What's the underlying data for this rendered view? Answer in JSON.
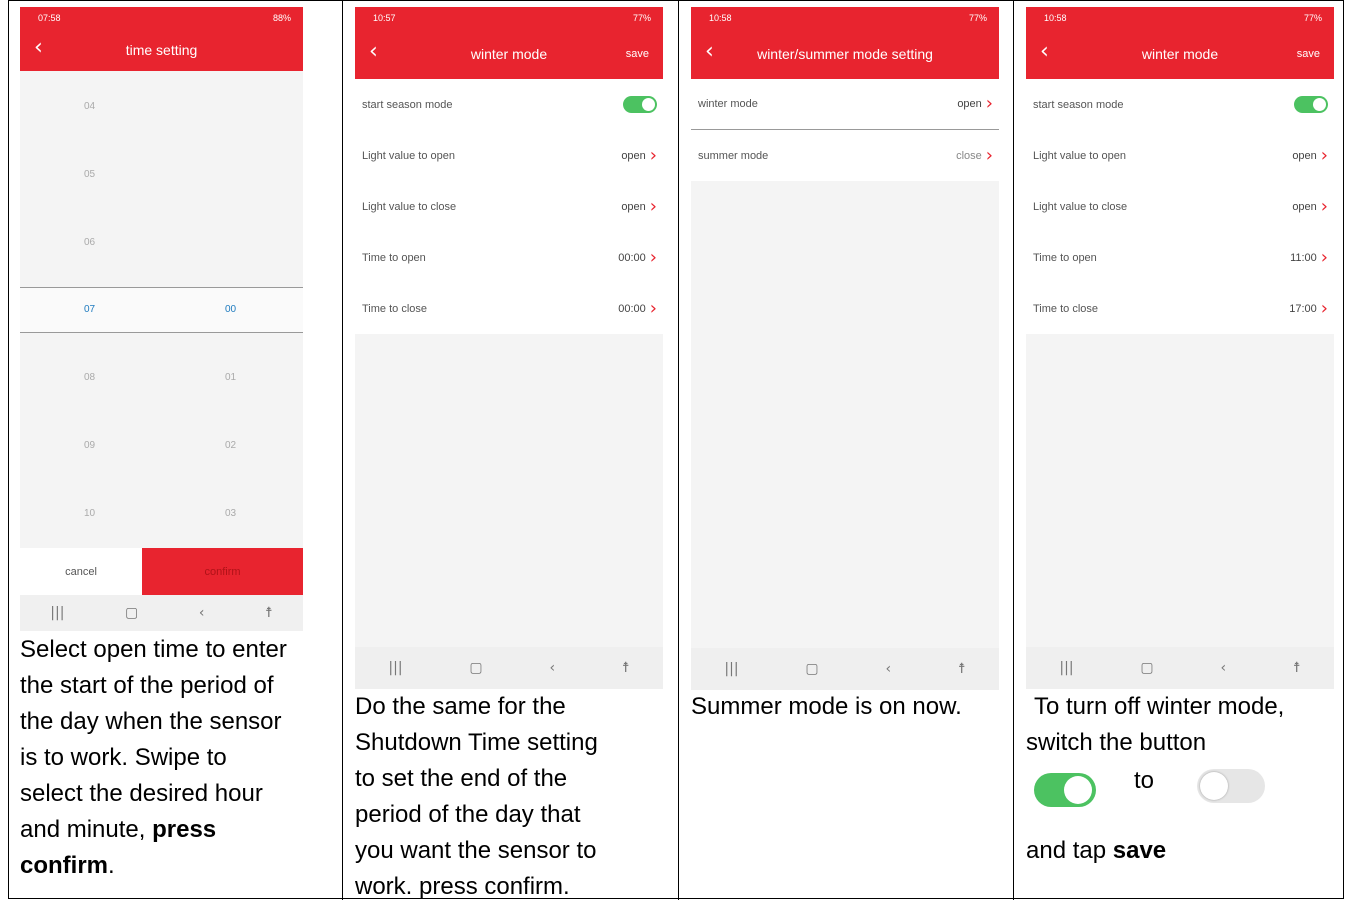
{
  "colors": {
    "accent": "#e8242f",
    "toggle_on": "#4cc261",
    "selected_text": "#1f7bbf"
  },
  "panels": [
    {
      "status_time": "07:58",
      "status_right": "88%",
      "title": "time setting",
      "picker": {
        "hours": [
          "04",
          "05",
          "06",
          "07",
          "08",
          "09",
          "10"
        ],
        "minutes": [
          "00",
          "01",
          "02",
          "03"
        ],
        "selected_hour": "07",
        "selected_minute": "00"
      },
      "cancel": "cancel",
      "confirm": "confirm",
      "caption": [
        "Select open time to enter",
        "the start of the period of",
        "the day when the sensor",
        "is to work. Swipe to",
        "select the desired hour",
        "and minute, ",
        "confirm",
        "."
      ],
      "caption_bold_1": "press",
      "caption_bold_2": "confirm"
    },
    {
      "status_time": "10:57",
      "status_right": "77%",
      "title": "winter mode",
      "save": "save",
      "rows": [
        {
          "label": "start season mode",
          "value": ""
        },
        {
          "label": "Light value to open",
          "value": "open"
        },
        {
          "label": "Light value to close",
          "value": "open"
        },
        {
          "label": "Time to open",
          "value": "00:00"
        },
        {
          "label": "Time to close",
          "value": "00:00"
        }
      ],
      "caption_lines": [
        "Do the same for the",
        "Shutdown Time setting",
        "to set the end of the",
        "period of the day that",
        "you want the sensor to",
        "work. press confirm."
      ]
    },
    {
      "status_time": "10:58",
      "status_right": "77%",
      "title": "winter/summer mode setting",
      "rows": [
        {
          "label": "winter mode",
          "value": "open"
        },
        {
          "label": "summer mode",
          "value": "close"
        }
      ],
      "caption_lines": [
        "Summer mode is on now."
      ]
    },
    {
      "status_time": "10:58",
      "status_right": "77%",
      "title": "winter mode",
      "save": "save",
      "rows": [
        {
          "label": "start season mode",
          "value": ""
        },
        {
          "label": "Light value to open",
          "value": "open"
        },
        {
          "label": "Light value to close",
          "value": "open"
        },
        {
          "label": "Time to open",
          "value": "11:00"
        },
        {
          "label": "Time to close",
          "value": "17:00"
        }
      ],
      "caption_line1": "To turn off winter mode,",
      "caption_line2": "switch the button",
      "caption_to": "to",
      "caption_line3": "and tap ",
      "caption_save": "save"
    }
  ],
  "nav_icons": [
    "recent-apps-icon",
    "home-icon",
    "back-icon",
    "accessibility-icon"
  ]
}
